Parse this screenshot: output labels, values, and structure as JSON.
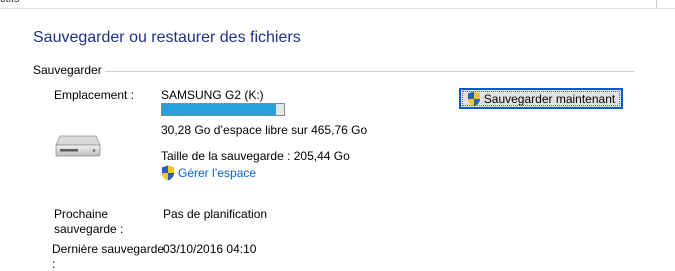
{
  "top_fragment": "ctifs",
  "title": "Sauvegarder ou restaurer des fichiers",
  "section": {
    "label": "Sauvegarder"
  },
  "backup": {
    "location_label": "Emplacement :",
    "drive_name": "SAMSUNG G2 (K:)",
    "usage_fraction": 0.935,
    "free_space": "30,28 Go d’espace libre sur 465,76 Go",
    "backup_size": "Taille de la sauvegarde : 205,44 Go",
    "manage_link": "Gérer l’espace",
    "backup_now_button": "Sauvegarder maintenant",
    "next_label_1": "Prochaine",
    "next_label_2": "sauvegarde :",
    "next_value": "Pas de planification",
    "last_label": "Dernière sauvegarde",
    "last_colon": ":",
    "last_value": "03/10/2016 04:10"
  },
  "colors": {
    "title": "#1e3287",
    "link": "#0066cc",
    "progress_fill": "#26a0da",
    "button_border": "#0a5ac8"
  },
  "icons": {
    "drive": "hard-drive-icon",
    "uac_shield": "uac-shield-icon"
  }
}
